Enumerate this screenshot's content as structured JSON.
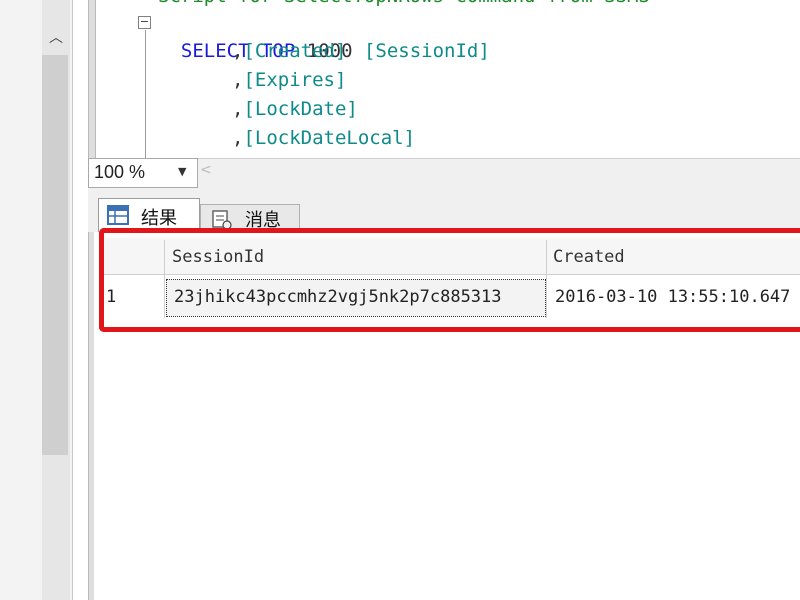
{
  "editor": {
    "comment_line": "Script for SelectTopNRows command from SSMS",
    "lines": [
      {
        "kw1": "SELECT",
        "kw2": "TOP",
        "num": "1000",
        "col": "[SessionId]"
      },
      {
        "comma": ",",
        "col": "[Created]"
      },
      {
        "comma": ",",
        "col": "[Expires]"
      },
      {
        "comma": ",",
        "col": "[LockDate]"
      },
      {
        "comma": ",",
        "col": "[LockDateLocal]"
      }
    ],
    "collapse_glyph": "−"
  },
  "zoom": {
    "value": "100 %",
    "arrow": "▼"
  },
  "tabs": [
    {
      "label": "结果",
      "icon": "grid-icon"
    },
    {
      "label": "消息",
      "icon": "message-icon"
    }
  ],
  "grid": {
    "columns": [
      "SessionId",
      "Created"
    ],
    "rows": [
      {
        "row_number": "1",
        "SessionId": "23jhikc43pccmhz2vgj5nk2p7c885313",
        "Created": "2016-03-10 13:55:10.647"
      }
    ]
  },
  "colors": {
    "highlight": "#e0161b",
    "keyword": "#1a1adb",
    "identifier": "#0f8a8a",
    "comment": "#1e8a2b"
  },
  "icons": {
    "scroll_up": "chevron-up-icon",
    "scroll_left": "chevron-left-icon"
  }
}
